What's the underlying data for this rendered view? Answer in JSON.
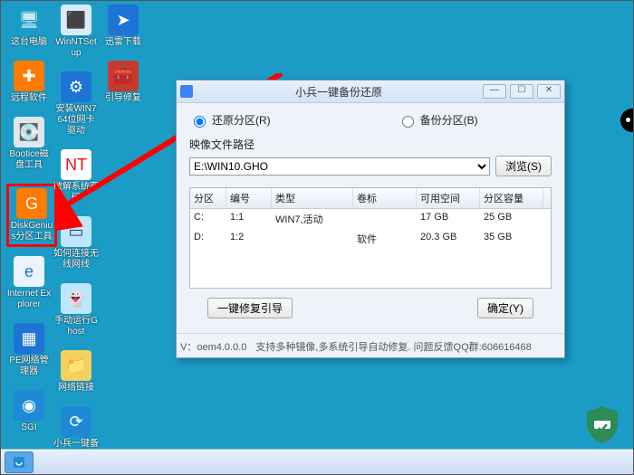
{
  "desktop": {
    "c1": [
      {
        "label": "这台电脑",
        "name": "this-pc-icon",
        "bg": "#ffffff00",
        "fg": "#cfe8f5",
        "sym": "🖥"
      },
      {
        "label": "远程软件",
        "name": "remote-software-icon",
        "bg": "#ff7a00",
        "fg": "#fff",
        "sym": "✚"
      },
      {
        "label": "Bootice磁盘工具",
        "name": "bootice-icon",
        "bg": "#e0e6ee",
        "fg": "#333",
        "sym": "💽"
      },
      {
        "label": "DiskGenius分区工具",
        "name": "diskgenius-icon",
        "bg": "#ff7a00",
        "fg": "#fff",
        "sym": "G",
        "hl": true
      },
      {
        "label": "Internet Explorer",
        "name": "ie-icon",
        "bg": "#eaf3ff",
        "fg": "#1e74d6",
        "sym": "e"
      },
      {
        "label": "PE网络管理器",
        "name": "pe-network-icon",
        "bg": "#1e74d6",
        "fg": "#fff",
        "sym": "▦"
      },
      {
        "label": "SGI",
        "name": "sgi-icon",
        "bg": "#1e8ad6",
        "fg": "#fff",
        "sym": "◉"
      }
    ],
    "c2": [
      {
        "label": "WinNTSetup",
        "name": "winntsetup-icon",
        "bg": "#d9ecff",
        "fg": "#1e5bd6",
        "sym": "⬛"
      },
      {
        "label": "安装WIN7 64位网卡驱动",
        "name": "install-win7-driver-icon",
        "bg": "#1e74d6",
        "fg": "#fff",
        "sym": "⚙"
      },
      {
        "label": "破解系统密码",
        "name": "crack-password-icon",
        "bg": "#ffffff",
        "fg": "#e11",
        "sym": "NT"
      },
      {
        "label": "如何连接无线网线",
        "name": "wifi-help-icon",
        "bg": "#bfe6ff",
        "fg": "#246",
        "sym": "▭"
      },
      {
        "label": "手动运行Ghost",
        "name": "ghost-icon",
        "bg": "#bde7ff",
        "fg": "#fff",
        "sym": "👻"
      },
      {
        "label": "网络链接",
        "name": "network-links-icon",
        "bg": "#f4d060",
        "fg": "#333",
        "sym": "📁"
      },
      {
        "label": "小兵一键备份还原",
        "name": "xiaobing-backup-icon",
        "bg": "#1e8ad6",
        "fg": "#fff",
        "sym": "⟳"
      }
    ],
    "c3": [
      {
        "label": "迅雷下载",
        "name": "xunlei-icon",
        "bg": "#1e74d6",
        "fg": "#fff",
        "sym": "➤"
      },
      {
        "label": "引导修复",
        "name": "boot-repair-icon",
        "bg": "#c63a2e",
        "fg": "#fff",
        "sym": "🧰"
      }
    ]
  },
  "window": {
    "title": "小兵一键备份还原",
    "restore_label": "还原分区(R)",
    "backup_label": "备份分区(B)",
    "img_label": "映像文件路径",
    "img_value": "E:\\WIN10.GHO",
    "browse": "浏览(S)",
    "columns": [
      "分区",
      "编号",
      "类型",
      "卷标",
      "可用空间",
      "分区容量"
    ],
    "rows": [
      [
        "C:",
        "1:1",
        "WIN7,活动",
        "",
        "17 GB",
        "25 GB"
      ],
      [
        "D:",
        "1:2",
        "",
        "软件",
        "20.3 GB",
        "35 GB"
      ]
    ],
    "repair_btn": "一键修复引导",
    "confirm_btn": "确定(Y)",
    "status_left": "V：oem4.0.0.0",
    "status_right": "支持多种镜像,多系统引导自动修复. 问题反馈QQ群:606616468"
  }
}
